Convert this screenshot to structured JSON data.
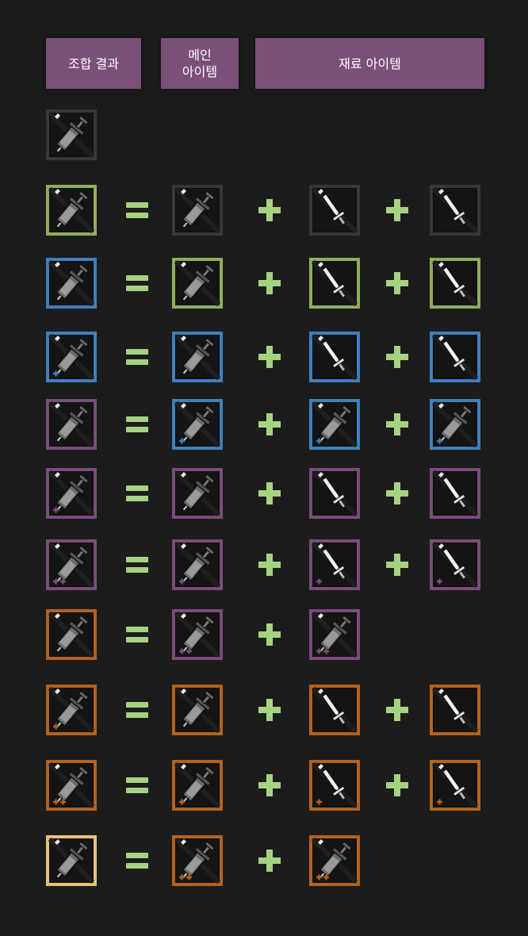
{
  "headers": {
    "result": "조합 결과",
    "main": "메인\n아이템",
    "materials": "재료 아이템"
  },
  "colors": {
    "gray": "#3a3834",
    "green": "#8fae5b",
    "blue": "#3e80bd",
    "purple": "#7a4d7a",
    "orange": "#b4621e",
    "gold": "#e8c27a",
    "operator": "#a6d381",
    "header_bg": "#7a4f78"
  },
  "rows": [
    {
      "result": {
        "tier": "gray",
        "plus": 0,
        "kind": "syringe"
      }
    },
    {
      "result": {
        "tier": "green",
        "plus": 0,
        "kind": "syringe"
      },
      "main": {
        "tier": "gray",
        "plus": 0,
        "kind": "syringe"
      },
      "materials": [
        {
          "tier": "gray",
          "plus": 0,
          "kind": "sword"
        },
        {
          "tier": "gray",
          "plus": 0,
          "kind": "sword"
        }
      ]
    },
    {
      "result": {
        "tier": "blue",
        "plus": 0,
        "kind": "syringe"
      },
      "main": {
        "tier": "green",
        "plus": 0,
        "kind": "syringe"
      },
      "materials": [
        {
          "tier": "green",
          "plus": 0,
          "kind": "sword"
        },
        {
          "tier": "green",
          "plus": 0,
          "kind": "sword"
        }
      ]
    },
    {
      "result": {
        "tier": "blue",
        "plus": 1,
        "kind": "syringe"
      },
      "main": {
        "tier": "blue",
        "plus": 0,
        "kind": "syringe"
      },
      "materials": [
        {
          "tier": "blue",
          "plus": 0,
          "kind": "sword"
        },
        {
          "tier": "blue",
          "plus": 0,
          "kind": "sword"
        }
      ]
    },
    {
      "result": {
        "tier": "purple",
        "plus": 0,
        "kind": "syringe"
      },
      "main": {
        "tier": "blue",
        "plus": 1,
        "kind": "syringe"
      },
      "materials": [
        {
          "tier": "blue",
          "plus": 1,
          "kind": "syringe"
        },
        {
          "tier": "blue",
          "plus": 1,
          "kind": "syringe"
        }
      ]
    },
    {
      "result": {
        "tier": "purple",
        "plus": 1,
        "kind": "syringe"
      },
      "main": {
        "tier": "purple",
        "plus": 0,
        "kind": "syringe"
      },
      "materials": [
        {
          "tier": "purple",
          "plus": 0,
          "kind": "sword"
        },
        {
          "tier": "purple",
          "plus": 0,
          "kind": "sword"
        }
      ]
    },
    {
      "result": {
        "tier": "purple",
        "plus": 2,
        "kind": "syringe"
      },
      "main": {
        "tier": "purple",
        "plus": 1,
        "kind": "syringe"
      },
      "materials": [
        {
          "tier": "purple",
          "plus": 1,
          "kind": "sword"
        },
        {
          "tier": "purple",
          "plus": 1,
          "kind": "sword"
        }
      ]
    },
    {
      "result": {
        "tier": "orange",
        "plus": 0,
        "kind": "syringe"
      },
      "main": {
        "tier": "purple",
        "plus": 2,
        "kind": "syringe"
      },
      "materials": [
        {
          "tier": "purple",
          "plus": 2,
          "kind": "syringe"
        }
      ]
    },
    {
      "result": {
        "tier": "orange",
        "plus": 1,
        "kind": "syringe"
      },
      "main": {
        "tier": "orange",
        "plus": 0,
        "kind": "syringe"
      },
      "materials": [
        {
          "tier": "orange",
          "plus": 0,
          "kind": "sword"
        },
        {
          "tier": "orange",
          "plus": 0,
          "kind": "sword"
        }
      ]
    },
    {
      "result": {
        "tier": "orange",
        "plus": 2,
        "kind": "syringe"
      },
      "main": {
        "tier": "orange",
        "plus": 1,
        "kind": "syringe"
      },
      "materials": [
        {
          "tier": "orange",
          "plus": 1,
          "kind": "sword"
        },
        {
          "tier": "orange",
          "plus": 1,
          "kind": "sword"
        }
      ]
    },
    {
      "result": {
        "tier": "gold",
        "plus": 0,
        "kind": "syringe"
      },
      "main": {
        "tier": "orange",
        "plus": 2,
        "kind": "syringe"
      },
      "materials": [
        {
          "tier": "orange",
          "plus": 2,
          "kind": "syringe"
        }
      ]
    }
  ]
}
